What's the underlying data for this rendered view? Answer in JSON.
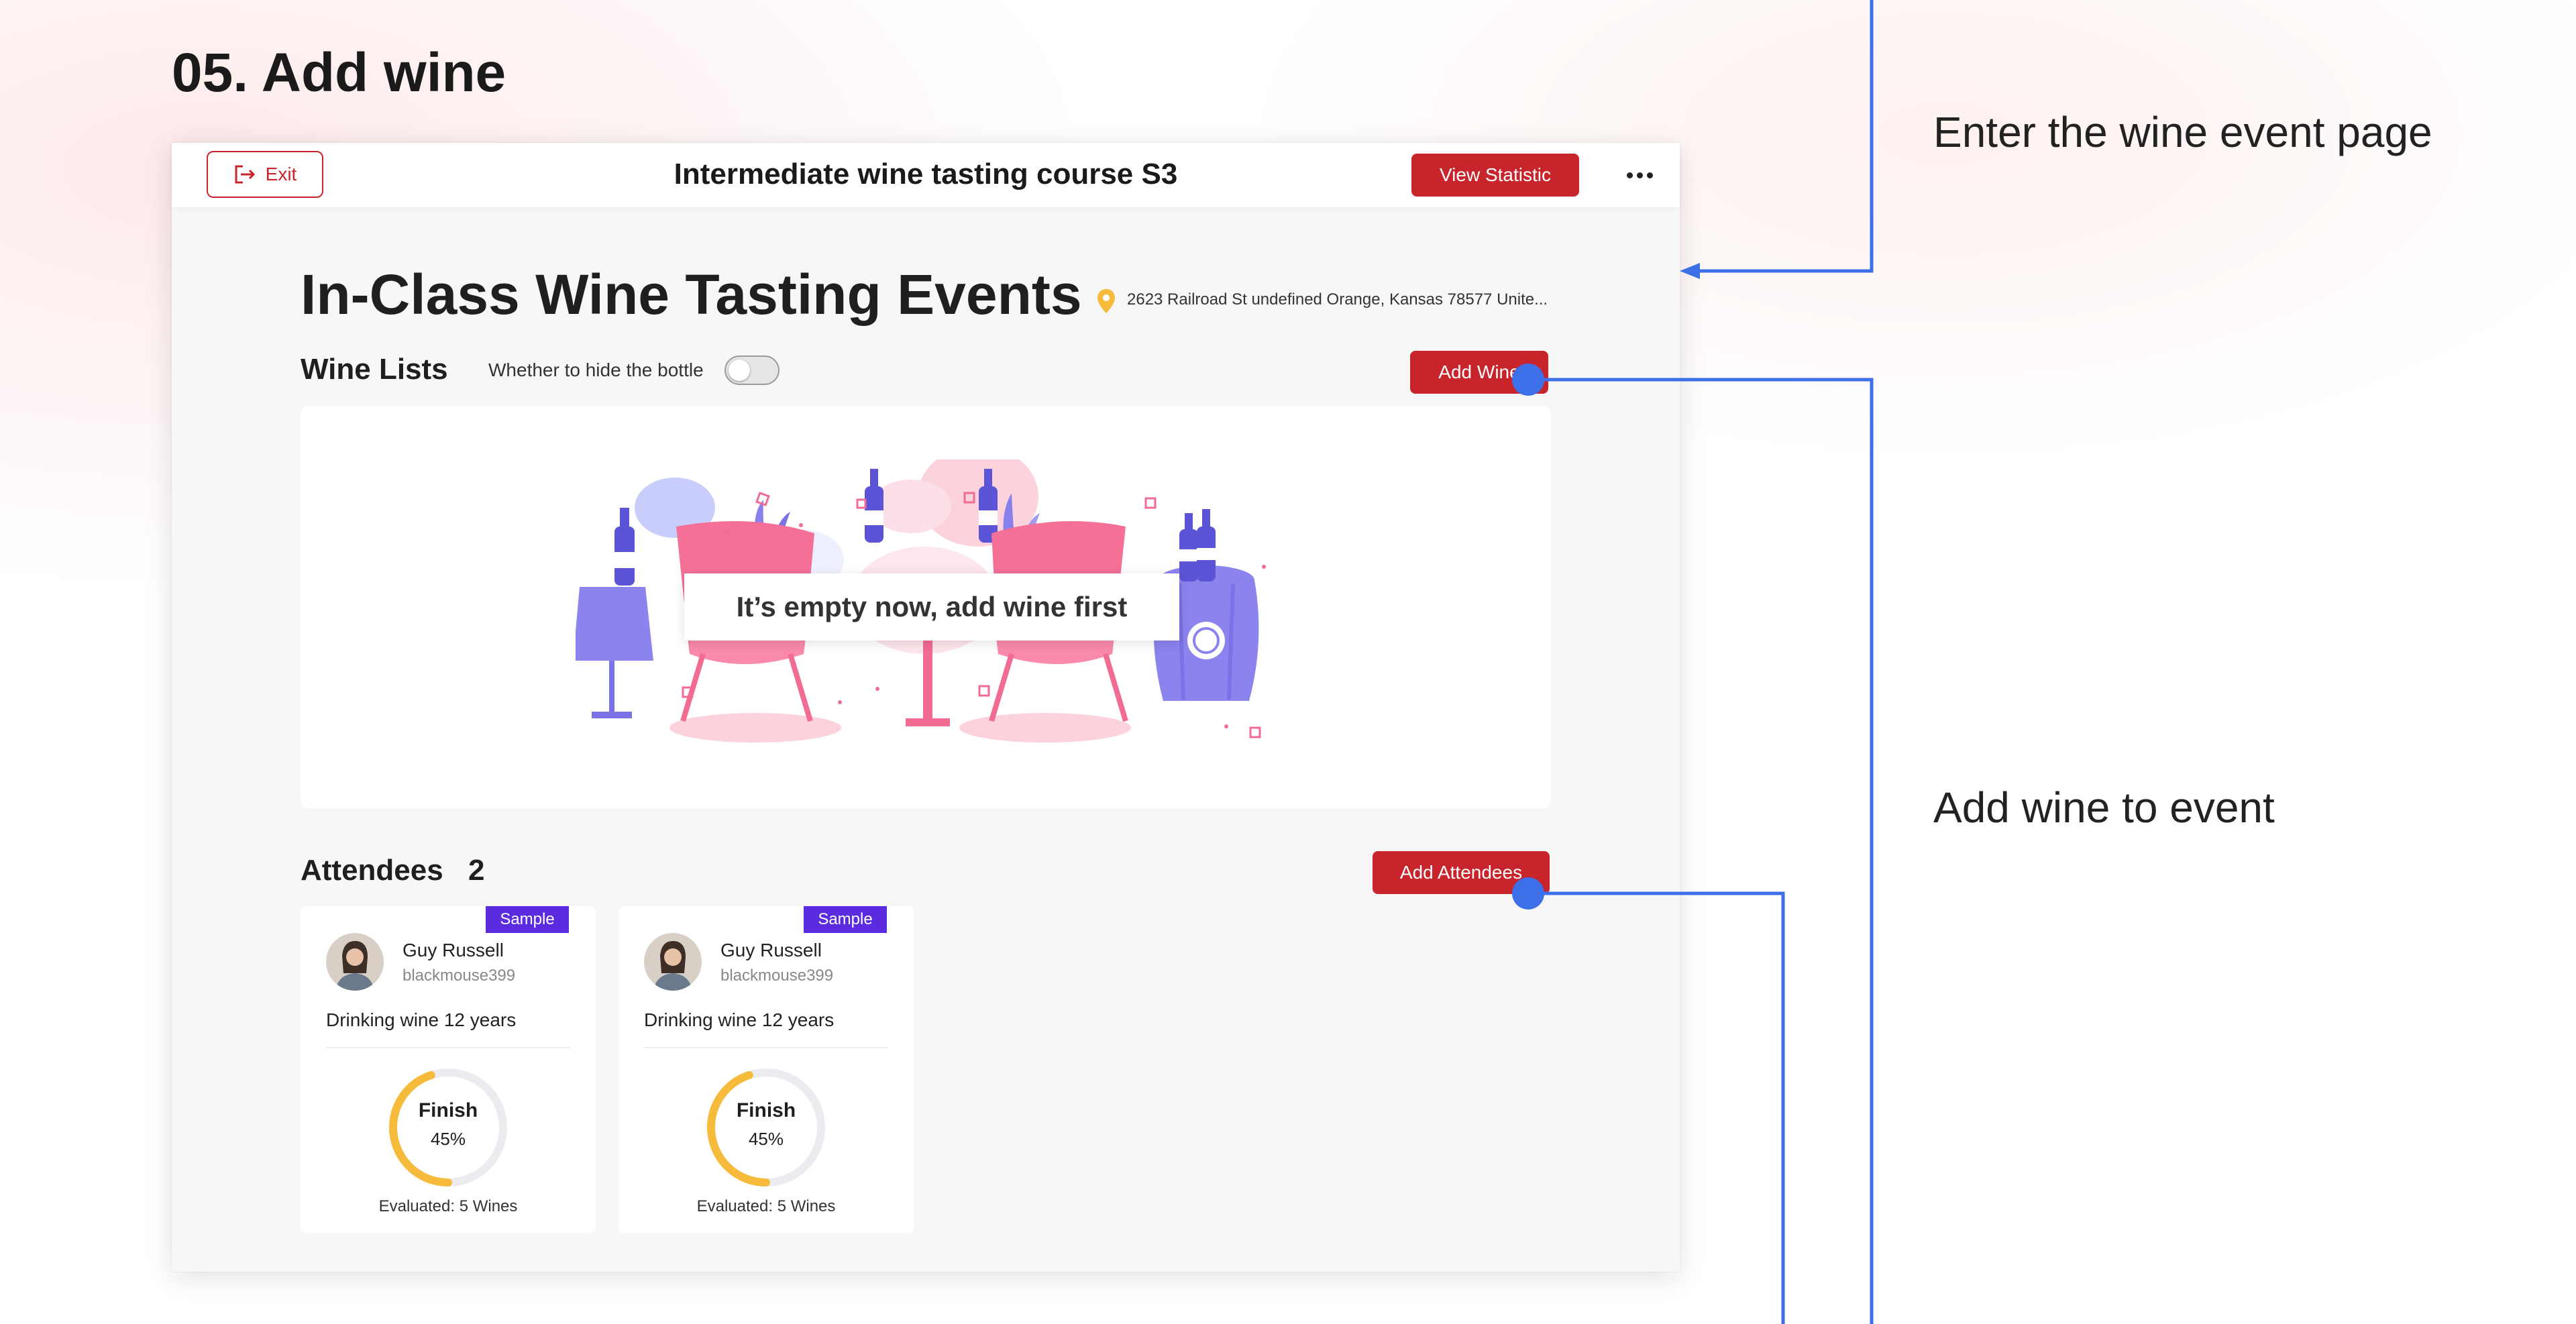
{
  "section_title": "05. Add wine",
  "annotations": {
    "enter_event": "Enter the wine event page",
    "add_wine": "Add wine to event"
  },
  "topbar": {
    "exit_label": "Exit",
    "window_title": "Intermediate wine tasting course S3",
    "view_statistic_label": "View Statistic",
    "more_icon": "more-horizontal-icon"
  },
  "event": {
    "title": "In-Class Wine Tasting Events",
    "address": "2623 Railroad St undefined Orange, Kansas 78577 Unite..."
  },
  "wine_lists": {
    "label": "Wine Lists",
    "hide_bottle_label": "Whether to hide the bottle",
    "hide_bottle_on": false,
    "add_wine_label": "Add Wine",
    "empty_message": "It’s empty now, add wine first"
  },
  "attendees": {
    "label": "Attendees",
    "count": "2",
    "add_label": "Add Attendees",
    "cards": [
      {
        "badge": "Sample",
        "name": "Guy Russell",
        "username": "blackmouse399",
        "description": "Drinking wine 12 years",
        "status": "Finish",
        "progress_text": "45%",
        "progress": 0.45,
        "evaluated": "Evaluated: 5 Wines"
      },
      {
        "badge": "Sample",
        "name": "Guy Russell",
        "username": "blackmouse399",
        "description": "Drinking wine 12 years",
        "status": "Finish",
        "progress_text": "45%",
        "progress": 0.45,
        "evaluated": "Evaluated: 5 Wines"
      }
    ]
  },
  "colors": {
    "brand_red": "#c8242c",
    "badge_purple": "#5b2be0",
    "progress_yellow": "#f6bb3a",
    "connector_blue": "#3d6fe8"
  }
}
